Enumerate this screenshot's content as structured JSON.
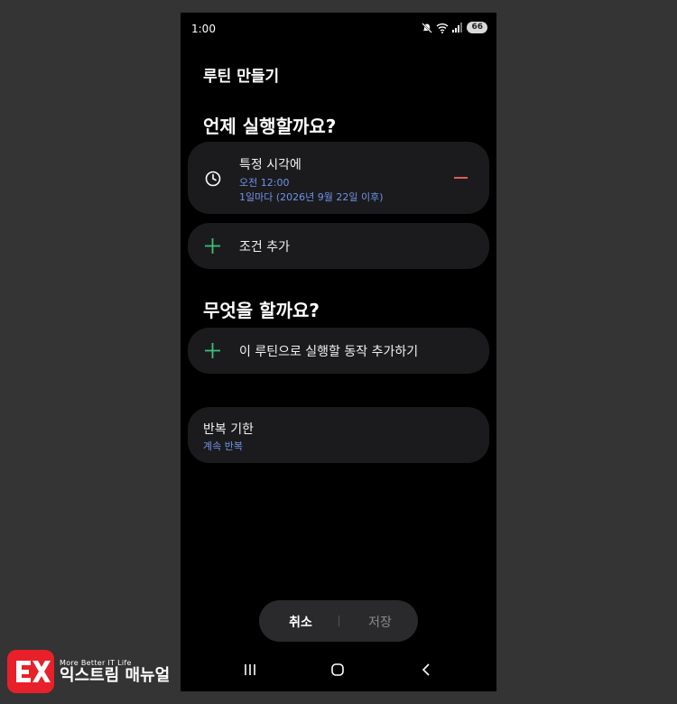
{
  "status_bar": {
    "time": "1:00",
    "battery": "66"
  },
  "page": {
    "title": "루틴 만들기"
  },
  "when": {
    "heading": "언제 실행할까요?",
    "condition": {
      "label": "특정 시각에",
      "time": "오전 12:00",
      "repeat": "1일마다 (2026년 9월 22일 이후)"
    },
    "add_condition_label": "조건 추가"
  },
  "what": {
    "heading": "무엇을 할까요?",
    "add_action_label": "이 루틴으로 실행할 동작 추가하기"
  },
  "repeat_limit": {
    "label": "반복 기한",
    "value": "계속 반복"
  },
  "actions": {
    "cancel_label": "취소",
    "save_label": "저장"
  },
  "watermark": {
    "tagline": "More Better IT Life",
    "name": "익스트림 매뉴얼"
  },
  "colors": {
    "accent_blue": "#6f93e8",
    "plus_green": "#3fbf7a",
    "minus_red": "#e05c5c"
  }
}
